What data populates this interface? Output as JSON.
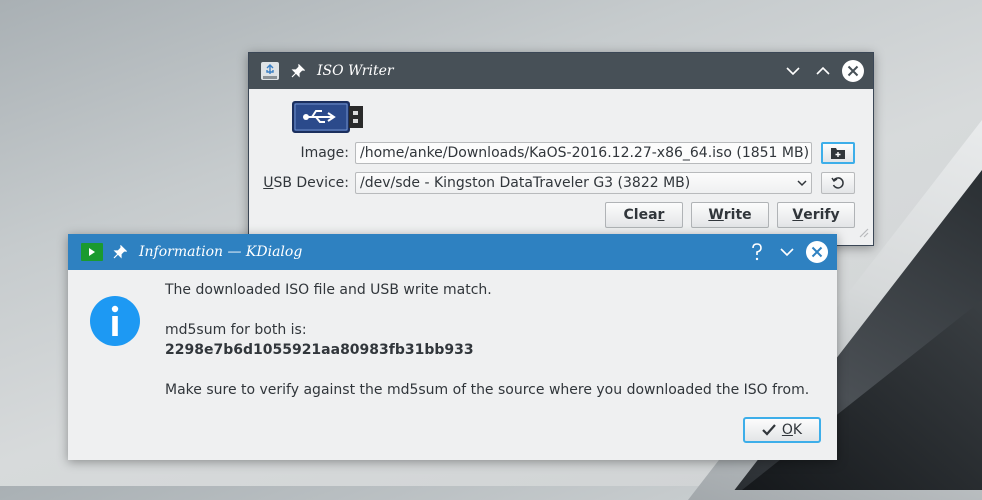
{
  "colors": {
    "iso_titlebar": "#475057",
    "dialog_titlebar": "#2e81c1",
    "focus": "#3daee9",
    "info_blue": "#1d99f3"
  },
  "iso_writer": {
    "title": "ISO Writer",
    "image_label": "Image:",
    "image_value": "/home/anke/Downloads/KaOS-2016.12.27-x86_64.iso (1851 MB)",
    "usb_label_accel": "U",
    "usb_label_rest": "SB Device:",
    "usb_value": "/dev/sde - Kingston DataTraveler G3 (3822 MB)",
    "clear_pre": "Clea",
    "clear_accel": "r",
    "write_accel": "W",
    "write_rest": "rite",
    "verify_accel": "V",
    "verify_rest": "erify",
    "icons": [
      "usb-drive-icon",
      "pin-icon",
      "minimize-icon",
      "maximize-icon",
      "close-icon",
      "open-folder-icon",
      "refresh-icon"
    ]
  },
  "dialog": {
    "title": "Information — KDialog",
    "line1": "The downloaded ISO file and USB write match.",
    "line2": "md5sum for both is:",
    "checksum": "2298e7b6d1055921aa80983fb31bb933",
    "line3": "Make sure to verify against the md5sum of the source where you downloaded the ISO from.",
    "ok_accel": "O",
    "ok_rest": "K",
    "icons": [
      "terminal-icon",
      "pin-icon",
      "help-icon",
      "minimize-icon",
      "close-icon",
      "information-icon",
      "checkmark-icon"
    ]
  }
}
